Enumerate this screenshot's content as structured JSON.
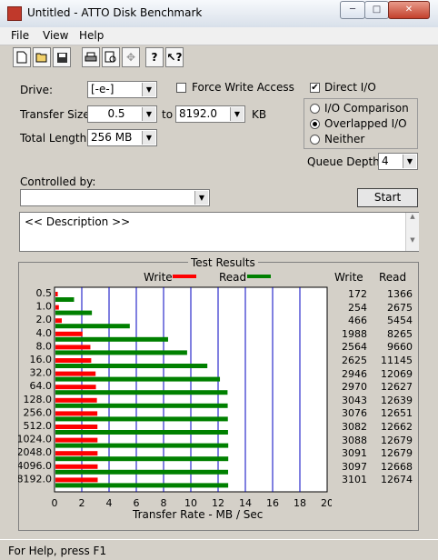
{
  "window": {
    "title": "Untitled - ATTO Disk Benchmark",
    "min": "─",
    "max": "□",
    "close": "✕"
  },
  "menu": [
    "File",
    "View",
    "Help"
  ],
  "toolbar": [
    "new-icon",
    "open-icon",
    "save-icon",
    "print-icon",
    "print-preview-icon",
    "move-icon",
    "help-icon",
    "context-help-icon"
  ],
  "settings": {
    "drive_label": "Drive:",
    "drive_value": "[-e-]",
    "force_write_label": "Force Write Access",
    "force_write_checked": false,
    "direct_io_label": "Direct I/O",
    "direct_io_checked": true,
    "transfer_size_label": "Transfer Size:",
    "transfer_from": "0.5",
    "to_label": "to",
    "transfer_to": "8192.0",
    "unit_label": "KB",
    "total_length_label": "Total Length:",
    "total_length_value": "256 MB",
    "io_comparison_label": "I/O Comparison",
    "overlapped_io_label": "Overlapped I/O",
    "neither_label": "Neither",
    "selected_mode": "overlapped",
    "queue_depth_label": "Queue Depth:",
    "queue_depth_value": "4",
    "controlled_by_label": "Controlled by:",
    "controlled_by_value": "",
    "start_label": "Start",
    "description_text": "<< Description >>"
  },
  "results": {
    "group_title": "Test Results",
    "legend_write": "Write",
    "legend_read": "Read",
    "col_write": "Write",
    "col_read": "Read",
    "write_color": "#ff0000",
    "read_color": "#008000",
    "xlabel": "Transfer Rate - MB / Sec",
    "rows": [
      {
        "size": "0.5",
        "write": "172",
        "read": "1366"
      },
      {
        "size": "1.0",
        "write": "254",
        "read": "2675"
      },
      {
        "size": "2.0",
        "write": "466",
        "read": "5454"
      },
      {
        "size": "4.0",
        "write": "1988",
        "read": "8265"
      },
      {
        "size": "8.0",
        "write": "2564",
        "read": "9660"
      },
      {
        "size": "16.0",
        "write": "2625",
        "read": "11145"
      },
      {
        "size": "32.0",
        "write": "2946",
        "read": "12069"
      },
      {
        "size": "64.0",
        "write": "2970",
        "read": "12627"
      },
      {
        "size": "128.0",
        "write": "3043",
        "read": "12639"
      },
      {
        "size": "256.0",
        "write": "3076",
        "read": "12651"
      },
      {
        "size": "512.0",
        "write": "3082",
        "read": "12662"
      },
      {
        "size": "1024.0",
        "write": "3088",
        "read": "12679"
      },
      {
        "size": "2048.0",
        "write": "3091",
        "read": "12679"
      },
      {
        "size": "4096.0",
        "write": "3097",
        "read": "12668"
      },
      {
        "size": "8192.0",
        "write": "3101",
        "read": "12674"
      }
    ]
  },
  "chart_data": {
    "type": "bar",
    "orientation": "horizontal",
    "categories": [
      "0.5",
      "1.0",
      "2.0",
      "4.0",
      "8.0",
      "16.0",
      "32.0",
      "64.0",
      "128.0",
      "256.0",
      "512.0",
      "1024.0",
      "2048.0",
      "4096.0",
      "8192.0"
    ],
    "series": [
      {
        "name": "Write",
        "values": [
          172,
          254,
          466,
          1988,
          2564,
          2625,
          2946,
          2970,
          3043,
          3076,
          3082,
          3088,
          3091,
          3097,
          3101
        ]
      },
      {
        "name": "Read",
        "values": [
          1366,
          2675,
          5454,
          8265,
          9660,
          11145,
          12069,
          12627,
          12639,
          12651,
          12662,
          12679,
          12679,
          12668,
          12674
        ]
      }
    ],
    "xlabel": "Transfer Rate - MB / Sec",
    "xticks": [
      "0",
      "2",
      "4",
      "6",
      "8",
      "10",
      "12",
      "14",
      "16",
      "18",
      "20"
    ],
    "xlim": [
      0,
      20
    ],
    "value_scale": 0.001
  },
  "status": {
    "text": "For Help, press F1"
  }
}
